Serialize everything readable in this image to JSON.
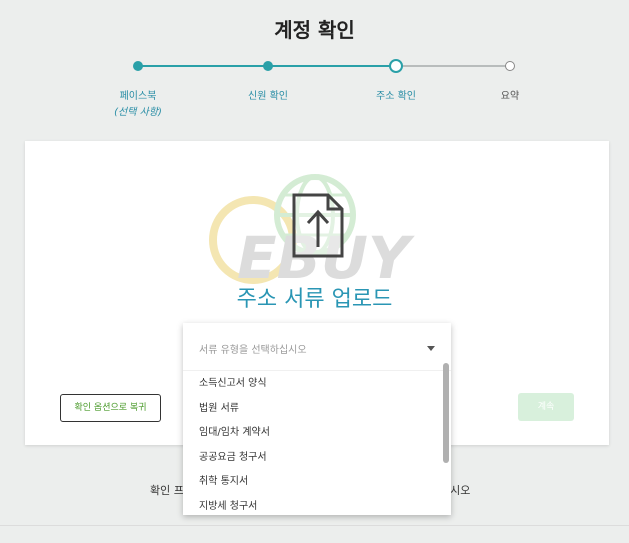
{
  "page": {
    "title": "계정 확인"
  },
  "stepper": {
    "steps": [
      {
        "label": "페이스북",
        "sub": "(선택 사항)",
        "state": "done"
      },
      {
        "label": "신원 확인",
        "state": "done"
      },
      {
        "label": "주소 확인",
        "state": "current"
      },
      {
        "label": "요약",
        "state": "todo"
      }
    ]
  },
  "card": {
    "upload_title": "주소 서류 업로드",
    "upload_icon": "upload-document-icon",
    "back_button": "확인 옵션으로 복귀",
    "continue_button": "계속"
  },
  "dropdown": {
    "placeholder": "서류 유형을 선택하십시오",
    "options": [
      "소득신고서 양식",
      "법원 서류",
      "임대/임차 계약서",
      "공공요금 청구서",
      "취학 통지서",
      "지방세 청구서"
    ]
  },
  "footer": {
    "left_text": "확인 프",
    "right_text": "십시오"
  },
  "watermark": {
    "text": "EBUY"
  },
  "colors": {
    "accent": "#2aa0a8",
    "title_blue": "#2a96b4",
    "back_text": "#4a9a2a",
    "continue_bg": "#d8f0dc"
  }
}
